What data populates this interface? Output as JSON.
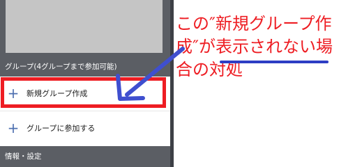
{
  "drawer": {
    "group_header": "グループ(4グループまで参加可能)",
    "items": [
      {
        "icon": "plus-icon",
        "icon_glyph": "+",
        "label": "新規グループ作成"
      },
      {
        "icon": "plus-icon",
        "icon_glyph": "+",
        "label": "グループに参加する"
      }
    ],
    "footer": "情報・設定"
  },
  "annotation": {
    "line1": "この″新規グループ作",
    "line2": "成″が表示されない場",
    "line3": "合の対処",
    "colors": {
      "text": "#ee1d23",
      "highlight_box": "#ee1d23",
      "arrow": "#3f4fcf"
    }
  }
}
